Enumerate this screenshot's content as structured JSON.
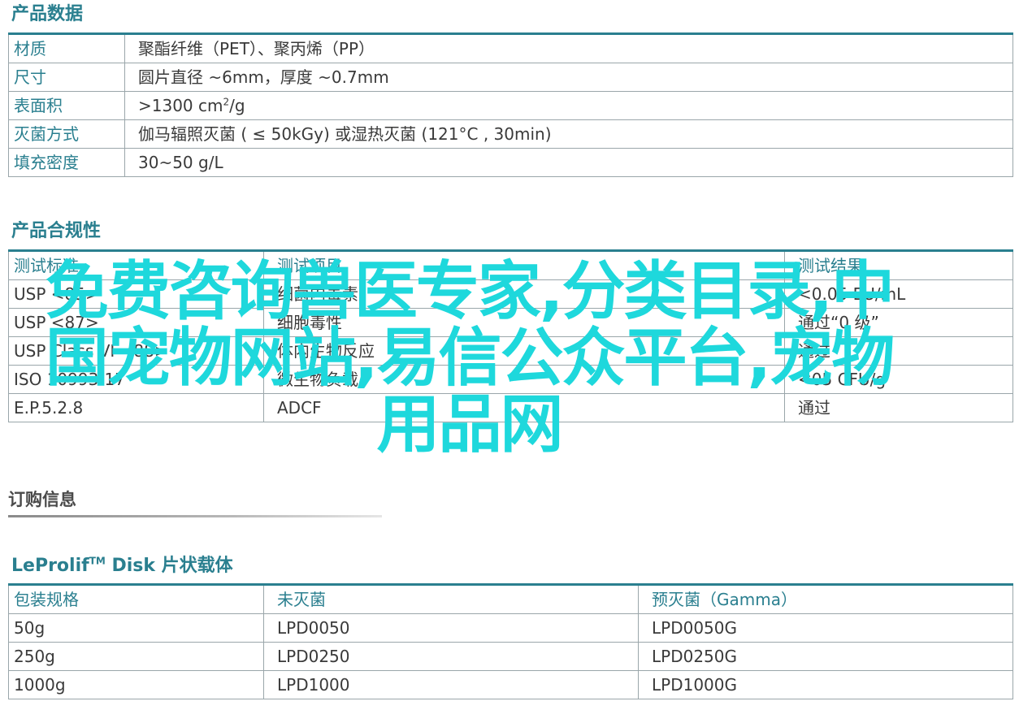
{
  "product_data": {
    "title": "产品数据",
    "rows": [
      {
        "label": "材质",
        "value": "聚酯纤维（PET）、聚丙烯（PP）"
      },
      {
        "label": "尺寸",
        "value": "圆片直径 ~6mm，厚度 ~0.7mm"
      },
      {
        "label": "表面积",
        "value": ">1300 cm",
        "value_sup": "2",
        "value_tail": "/g"
      },
      {
        "label": "灭菌方式",
        "value": "伽马辐照灭菌 ( ≤ 50kGy) 或湿热灭菌 (121°C , 30min)"
      },
      {
        "label": "填充密度",
        "value": "30~50 g/L"
      }
    ]
  },
  "compliance": {
    "title": "产品合规性",
    "headers": [
      "测试标准",
      "测试项目",
      "测试结果"
    ],
    "rows": [
      [
        "USP <85>",
        "细菌内毒素",
        "<0.05 EU/mL"
      ],
      [
        "USP <87>",
        "细胞毒性",
        "通过“0 级”"
      ],
      [
        "USP Class VI <88>",
        "体内生物反应",
        "通过"
      ],
      [
        "ISO 10993-17",
        "微生物负载",
        "<05 CFU/g"
      ],
      [
        "E.P.5.2.8",
        "ADCF",
        "通过"
      ]
    ]
  },
  "overlay": {
    "text": "免费咨询兽医专家,分类目录,中国宠物网站,易信公众平台,宠物用品网",
    "color": "#1ed8dc"
  },
  "order_info": {
    "title": "订购信息"
  },
  "order_table": {
    "title_main": "LeProlif",
    "title_sup": "TM",
    "title_tail": " Disk 片状载体",
    "headers": [
      "包装规格",
      "未灭菌",
      "预灭菌（Gamma）"
    ],
    "rows": [
      [
        "50g",
        "LPD0050",
        "LPD0050G"
      ],
      [
        "250g",
        "LPD0250",
        "LPD0250G"
      ],
      [
        "1000g",
        "LPD1000",
        "LPD1000G"
      ]
    ]
  },
  "colors": {
    "accent": "#2a7f8f",
    "border": "#9aa6aa",
    "text": "#3a3a3a"
  }
}
